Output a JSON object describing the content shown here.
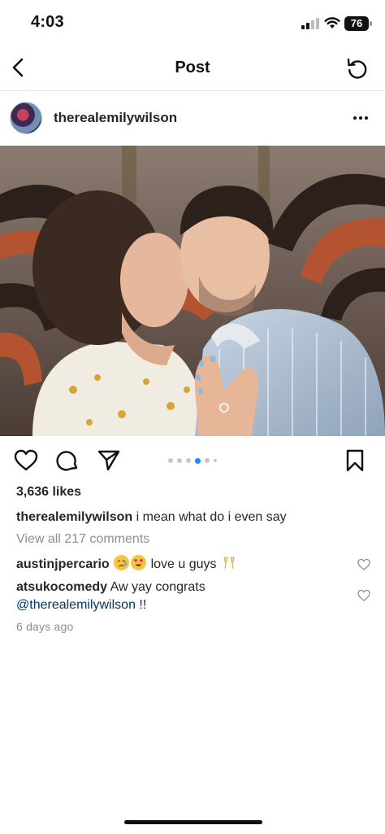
{
  "status_bar": {
    "time": "4:03",
    "battery": "76"
  },
  "nav": {
    "title": "Post"
  },
  "post": {
    "username": "therealemilywilson",
    "likes": "3,636 likes",
    "caption_user": "therealemilywilson",
    "caption_text": " i mean what do i even say",
    "view_all": "View all 217 comments",
    "timestamp": "6 days ago",
    "carousel": {
      "count": 6,
      "active_index": 3
    }
  },
  "comments": [
    {
      "user": "austinjpercario",
      "text_after_emojis": " love u guys",
      "emojis": [
        "crying-face",
        "heart-eyes-face",
        "clinking-glasses"
      ]
    },
    {
      "user": "atsukocomedy",
      "text": " Aw yay congrats",
      "mention": "@therealemilywilson",
      "after_mention": " !!"
    }
  ]
}
